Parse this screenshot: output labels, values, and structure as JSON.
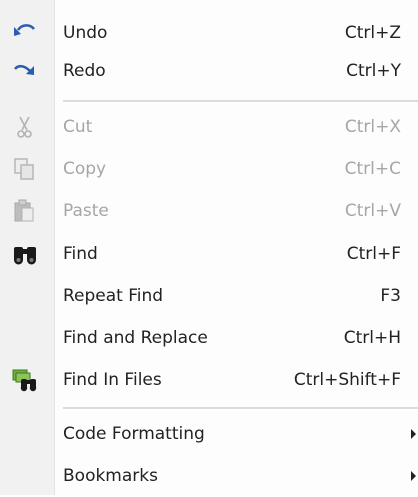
{
  "menu": {
    "items": [
      {
        "label": "Undo",
        "shortcut": "Ctrl+Z",
        "icon": "undo-icon"
      },
      {
        "label": "Redo",
        "shortcut": "Ctrl+Y",
        "icon": "redo-icon"
      },
      {
        "label": "Cut",
        "shortcut": "Ctrl+X",
        "icon": "scissors-icon",
        "state": "disabled"
      },
      {
        "label": "Copy",
        "shortcut": "Ctrl+C",
        "icon": "copy-icon",
        "state": "disabled"
      },
      {
        "label": "Paste",
        "shortcut": "Ctrl+V",
        "icon": "clipboard-icon",
        "state": "disabled"
      },
      {
        "label": "Find",
        "shortcut": "Ctrl+F",
        "icon": "binoculars-icon"
      },
      {
        "label": "Repeat Find",
        "shortcut": "F3"
      },
      {
        "label": "Find and Replace",
        "shortcut": "Ctrl+H"
      },
      {
        "label": "Find In Files",
        "shortcut": "Ctrl+Shift+F",
        "icon": "find-in-files-icon"
      },
      {
        "label": "Code Formatting",
        "submenu": true
      },
      {
        "label": "Bookmarks",
        "submenu": true
      }
    ]
  }
}
